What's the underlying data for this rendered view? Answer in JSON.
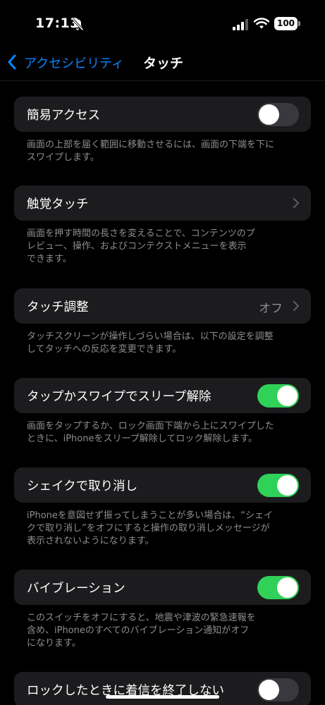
{
  "status_bar": {
    "time": "17:13",
    "battery": "100",
    "icons": [
      "bell-slash-icon",
      "signal-icon",
      "wifi-icon",
      "battery-icon"
    ]
  },
  "nav": {
    "back_label": "アクセシビリティ",
    "title": "タッチ"
  },
  "colors": {
    "background": "#000000",
    "cell": "#1c1c1e",
    "accent": "#0a84ff",
    "toggle_on": "#30d158",
    "toggle_off": "#39393d",
    "secondary_text": "#8e8e93"
  },
  "settings": [
    {
      "label": "簡易アクセス",
      "control": "toggle",
      "on": false,
      "footnote": [
        "画面の上部を届く範囲に移動させるには、画面の下端を下に",
        "スワイプします。"
      ]
    },
    {
      "label": "触覚タッチ",
      "control": "chevron",
      "footnote": [
        "画面を押す時間の長さを変えることで、コンテンツのプ",
        "レビュー、操作、およびコンテクストメニューを表示",
        "できます。"
      ]
    },
    {
      "label": "タッチ調整",
      "control": "chevron",
      "value": "オフ",
      "footnote": [
        "タッチスクリーンが操作しづらい場合は、以下の設定を調整",
        "してタッチへの反応を変更できます。"
      ]
    },
    {
      "label": "タップかスワイプでスリープ解除",
      "control": "toggle",
      "on": true,
      "footnote": [
        "画面をタップするか、ロック画面下端から上にスワイプした",
        "ときに、iPhoneをスリープ解除してロック解除します。"
      ]
    },
    {
      "label": "シェイクで取り消し",
      "control": "toggle",
      "on": true,
      "footnote": [
        "iPhoneを意図せず振ってしまうことが多い場合は、“シェイ",
        "クで取り消し”をオフにすると操作の取り消しメッセージが",
        "表示されないようになります。"
      ]
    },
    {
      "label": "バイブレーション",
      "control": "toggle",
      "on": true,
      "footnote": [
        "このスイッチをオフにすると、地震や津波の緊急速報を",
        "含め、iPhoneのすべてのバイブレーション通知がオフ",
        "になります。"
      ]
    },
    {
      "label": "ロックしたときに着信を終了しない",
      "control": "toggle",
      "on": false,
      "footnote": []
    }
  ]
}
